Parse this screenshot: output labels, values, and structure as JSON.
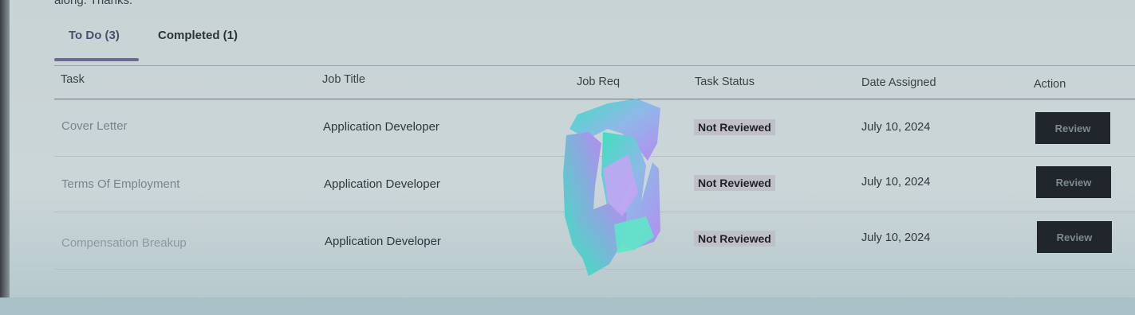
{
  "notice": "along. Thanks.",
  "tabs": [
    {
      "label": "To Do (3)"
    },
    {
      "label": "Completed (1)"
    }
  ],
  "table": {
    "headers": {
      "task": "Task",
      "job_title": "Job Title",
      "job_req": "Job Req",
      "task_status": "Task Status",
      "date_assigned": "Date Assigned",
      "action": "Action"
    },
    "rows": [
      {
        "task": "Cover Letter",
        "job_title": "Application Developer",
        "status": "Not Reviewed",
        "date": "July 10, 2024",
        "action": "Review"
      },
      {
        "task": "Terms Of Employment",
        "job_title": "Application Developer",
        "status": "Not Reviewed",
        "date": "July 10, 2024",
        "action": "Review"
      },
      {
        "task": "Compensation Breakup",
        "job_title": "Application Developer",
        "status": "Not Reviewed",
        "date": "July 10, 2024",
        "action": "Review"
      }
    ]
  },
  "colors": {
    "tab_underline": "#6e6a8f",
    "button_bg": "#20262b",
    "status_bg": "#bfc0c8",
    "redaction_a": "#3fe0c0",
    "redaction_b": "#b48cf0"
  }
}
